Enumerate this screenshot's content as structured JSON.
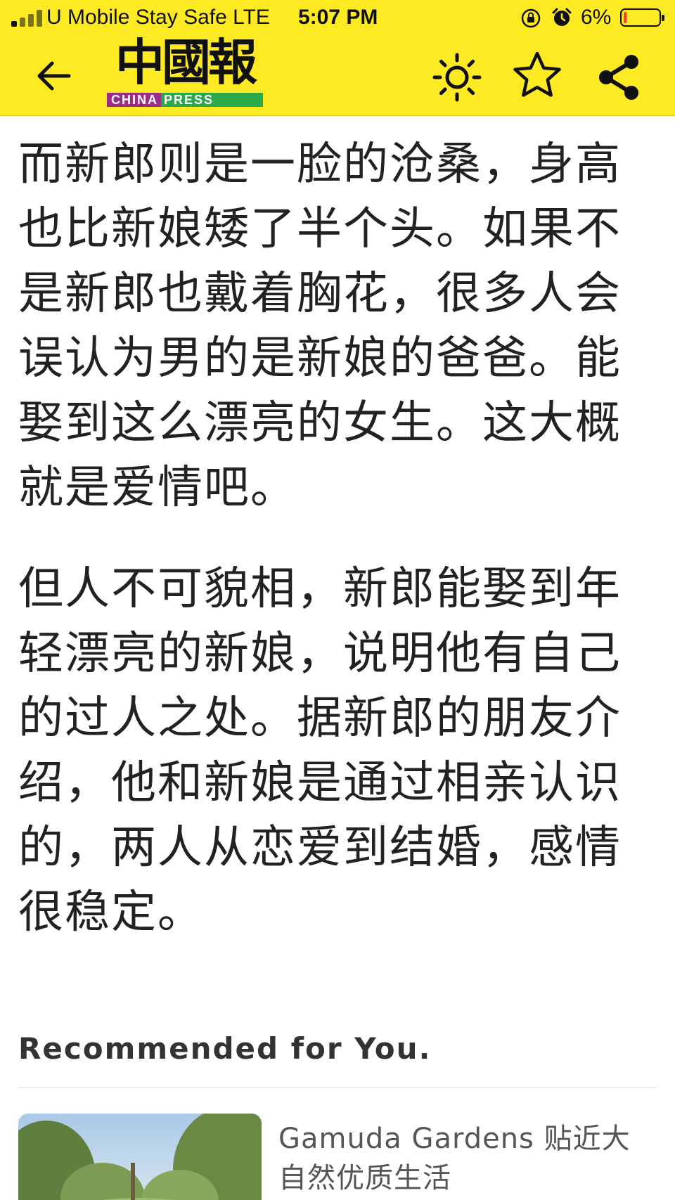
{
  "status_bar": {
    "carrier": "U Mobile Stay Safe  LTE",
    "time": "5:07 PM",
    "battery": "6%",
    "battery_level": 0.06,
    "icons": [
      "signal-icon",
      "orientation-lock-icon",
      "alarm-icon",
      "battery-icon"
    ]
  },
  "app_bar": {
    "logo_text": "中國報",
    "logo_sub_left": "CHINA",
    "logo_sub_right": "PRESS",
    "icons": [
      "back-arrow-icon",
      "brightness-icon",
      "star-icon",
      "share-icon"
    ],
    "background": "#fdea22"
  },
  "article": {
    "paragraphs": [
      "而新郎则是一脸的沧桑，身高也比新娘矮了半个头。如果不是新郎也戴着胸花，很多人会误认为男的是新娘的爸爸。能娶到这么漂亮的女生。这大概就是爱情吧。",
      "但人不可貌相，新郎能娶到年轻漂亮的新娘，说明他有自己的过人之处。据新郎的朋友介绍，他和新娘是通过相亲认识的，两人从恋爱到结婚，感情很稳定。"
    ]
  },
  "recommended": {
    "heading": "Recommended for You.",
    "items": [
      {
        "title": "Gamuda Gardens 贴近大自然优质生活"
      }
    ]
  }
}
